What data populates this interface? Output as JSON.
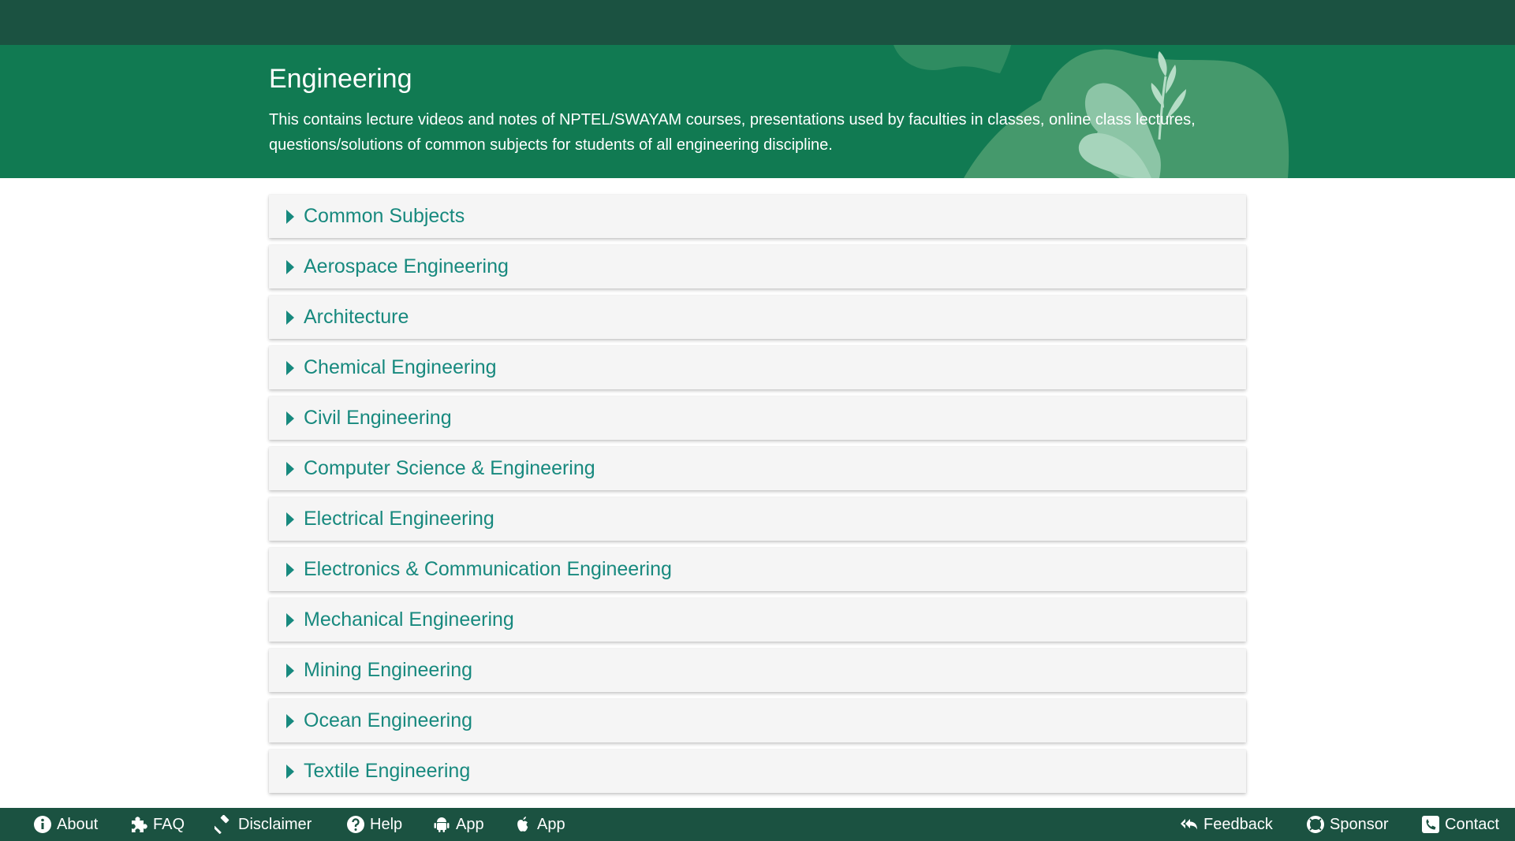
{
  "header": {
    "title": "Engineering",
    "description": "This contains lecture videos and notes of NPTEL/SWAYAM courses, presentations used by faculties in classes, online class lectures, questions/solutions of common subjects for students of all engineering discipline."
  },
  "categories": [
    {
      "label": "Common Subjects"
    },
    {
      "label": "Aerospace Engineering"
    },
    {
      "label": "Architecture"
    },
    {
      "label": "Chemical Engineering"
    },
    {
      "label": "Civil Engineering"
    },
    {
      "label": "Computer Science & Engineering"
    },
    {
      "label": "Electrical Engineering"
    },
    {
      "label": "Electronics & Communication Engineering"
    },
    {
      "label": "Mechanical Engineering"
    },
    {
      "label": "Mining Engineering"
    },
    {
      "label": "Ocean Engineering"
    },
    {
      "label": "Textile Engineering"
    }
  ],
  "footer": {
    "left": [
      {
        "label": "About",
        "icon": "info-icon"
      },
      {
        "label": "FAQ",
        "icon": "puzzle-icon"
      },
      {
        "label": "Disclaimer",
        "icon": "gavel-icon"
      },
      {
        "label": "Help",
        "icon": "question-icon"
      },
      {
        "label": "App",
        "icon": "android-icon"
      },
      {
        "label": "App",
        "icon": "apple-icon"
      }
    ],
    "right": [
      {
        "label": "Feedback",
        "icon": "reply-all-icon"
      },
      {
        "label": "Sponsor",
        "icon": "lifering-icon"
      },
      {
        "label": "Contact",
        "icon": "phone-icon"
      }
    ]
  },
  "colors": {
    "topbar": "#1b5241",
    "hero": "#117a52",
    "accent": "#17897e",
    "item_bg": "#f5f5f5"
  }
}
